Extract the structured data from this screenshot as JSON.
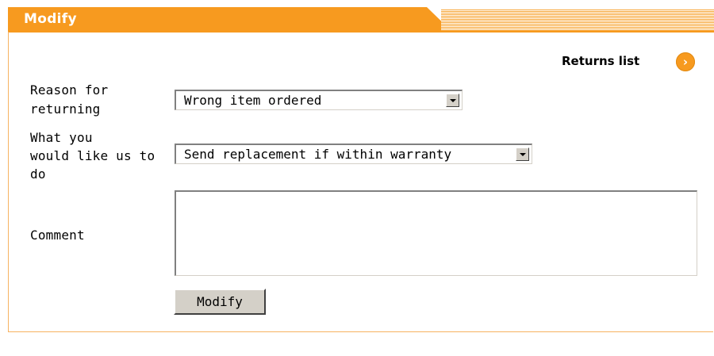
{
  "header": {
    "title": "Modify"
  },
  "returns_link": {
    "label": "Returns list",
    "icon": "chevron-right-circle-icon"
  },
  "form": {
    "reason_label": "Reason for returning",
    "reason_label_line1": "Reason for",
    "reason_label_line2": "returning",
    "reason_value": "Wrong item ordered",
    "action_label_line1": "What you",
    "action_label_line2": "would like us to",
    "action_label_line3": "do",
    "action_value": "Send replacement if within warranty",
    "comment_label": "Comment",
    "comment_value": "",
    "submit_label": "Modify"
  },
  "colors": {
    "accent": "#f79a1f",
    "button_face": "#d4d0c8"
  }
}
